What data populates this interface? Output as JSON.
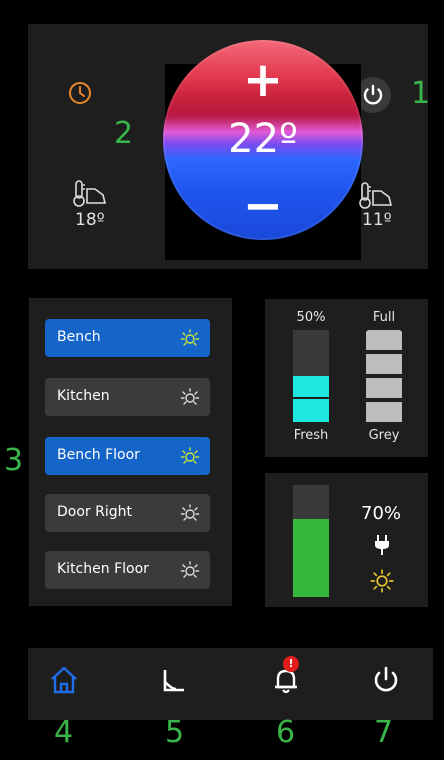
{
  "climate": {
    "target_temp": "22º",
    "inside_temp": "18º",
    "outside_temp": "11º",
    "plus_symbol": "+",
    "minus_symbol": "−"
  },
  "lights": {
    "items": [
      {
        "label": "Bench",
        "state": "on"
      },
      {
        "label": "Kitchen",
        "state": "off"
      },
      {
        "label": "Bench Floor",
        "state": "on"
      },
      {
        "label": "Door Right",
        "state": "off"
      },
      {
        "label": "Kitchen Floor",
        "state": "off"
      }
    ]
  },
  "tanks": {
    "fresh": {
      "label": "Fresh",
      "level_text": "50%",
      "level": 0.5
    },
    "grey": {
      "label": "Grey",
      "level_text": "Full",
      "level": 1.0
    }
  },
  "battery": {
    "percent_text": "70%",
    "level": 0.7
  },
  "callouts": [
    "1",
    "2",
    "3",
    "4",
    "5",
    "6",
    "7"
  ],
  "colors": {
    "accent_blue": "#1565c9",
    "callout_green": "#39b54a",
    "clock_orange": "#e8872a",
    "light_on_yellow": "#c6e63a",
    "fresh_cyan": "#1ce8e0",
    "battery_green": "#35b83b",
    "alert_red": "#e21b1b"
  },
  "nav": {
    "items": [
      "home-icon",
      "ramp-icon",
      "notifications-icon",
      "power-icon"
    ]
  }
}
